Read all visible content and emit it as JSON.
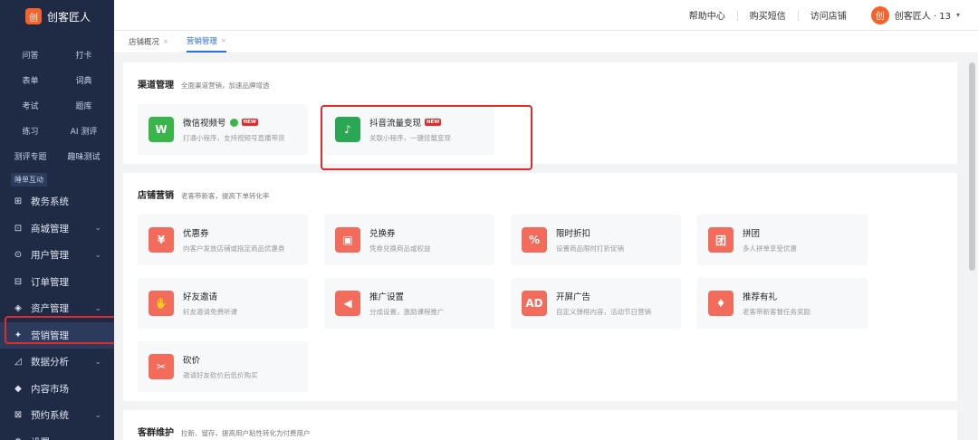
{
  "brand": {
    "name": "创客匠人",
    "logo_char": "创"
  },
  "sidebar": {
    "partial_items": [
      "",
      ""
    ],
    "sub_items": [
      "问答",
      "打卡",
      "表单",
      "词典",
      "考试",
      "题库",
      "练习",
      "AI 测评",
      "测评专题",
      "趣味测试"
    ],
    "group_tag": "睡单互动",
    "nav": [
      {
        "icon": "⊞",
        "icon_name": "edu-system-icon",
        "label": "教务系统",
        "chevron": false
      },
      {
        "icon": "⊡",
        "icon_name": "cart-icon",
        "label": "商城管理",
        "chevron": true
      },
      {
        "icon": "⊙",
        "icon_name": "user-icon",
        "label": "用户管理",
        "chevron": true
      },
      {
        "icon": "⊟",
        "icon_name": "order-icon",
        "label": "订单管理",
        "chevron": false
      },
      {
        "icon": "◈",
        "icon_name": "shield-icon",
        "label": "资产管理",
        "chevron": true
      },
      {
        "icon": "✦",
        "icon_name": "marketing-icon",
        "label": "营销管理",
        "chevron": false,
        "active": true
      },
      {
        "icon": "◿",
        "icon_name": "chart-icon",
        "label": "数据分析",
        "chevron": true
      },
      {
        "icon": "◆",
        "icon_name": "market-icon",
        "label": "内容市场",
        "chevron": false
      },
      {
        "icon": "⊠",
        "icon_name": "booking-icon",
        "label": "预约系统",
        "chevron": true
      },
      {
        "icon": "⚙",
        "icon_name": "gear-icon",
        "label": "设置",
        "chevron": true
      }
    ]
  },
  "header": {
    "links": [
      "帮助中心",
      "购买短信",
      "访问店铺"
    ],
    "user": {
      "avatar_char": "创",
      "name": "创客匠人 · 13",
      "chevron": "▾"
    }
  },
  "tabs": [
    {
      "label": "店铺概况",
      "close": "×"
    },
    {
      "label": "营销管理",
      "close": "×",
      "active": true
    }
  ],
  "panels": [
    {
      "title": "渠道管理",
      "desc": "全面渠道营销，加速品牌增透",
      "cards": [
        {
          "icon": "W",
          "icon_name": "wechat-video-icon",
          "color": "green",
          "name": "微信视频号",
          "dot": true,
          "new": "NEW",
          "sub": "打通小程序，支持视频号直播带货"
        },
        {
          "icon": "♪",
          "icon_name": "douyin-icon",
          "color": "green2",
          "name": "抖音流量变现",
          "new": "NEW",
          "sub": "关联小程序，一键挂载变现"
        }
      ]
    },
    {
      "title": "店铺营销",
      "desc": "老客带新客，提高下单转化率",
      "cards": [
        {
          "icon": "¥",
          "icon_name": "coupon-icon",
          "name": "优惠券",
          "sub": "向客户发放店铺或指定商品优惠券"
        },
        {
          "icon": "▣",
          "icon_name": "exchange-coupon-icon",
          "name": "兑换券",
          "sub": "凭券兑换商品或权益"
        },
        {
          "icon": "%",
          "icon_name": "discount-icon",
          "name": "限时折扣",
          "sub": "设置商品限时打折促销"
        },
        {
          "icon": "团",
          "icon_name": "group-buy-icon",
          "name": "拼团",
          "sub": "多人拼单享受优惠"
        },
        {
          "icon": "✋",
          "icon_name": "handshake-icon",
          "name": "好友邀请",
          "sub": "好友邀请免费听课"
        },
        {
          "icon": "◀",
          "icon_name": "megaphone-icon",
          "name": "推广设置",
          "sub": "分成设置，激励课程推广"
        },
        {
          "icon": "AD",
          "icon_name": "ad-icon",
          "name": "开屏广告",
          "sub": "自定义弹框内容，活动节日营销"
        },
        {
          "icon": "♦",
          "icon_name": "gift-icon",
          "name": "推荐有礼",
          "sub": "老客带新客督任务奖励"
        },
        {
          "icon": "✂",
          "icon_name": "bargain-icon",
          "name": "砍价",
          "sub": "邀请好友砍价后低价购买"
        }
      ]
    },
    {
      "title": "客群维护",
      "desc": "拉新、留存，提高用户粘性转化为付费用户",
      "cards": []
    }
  ]
}
